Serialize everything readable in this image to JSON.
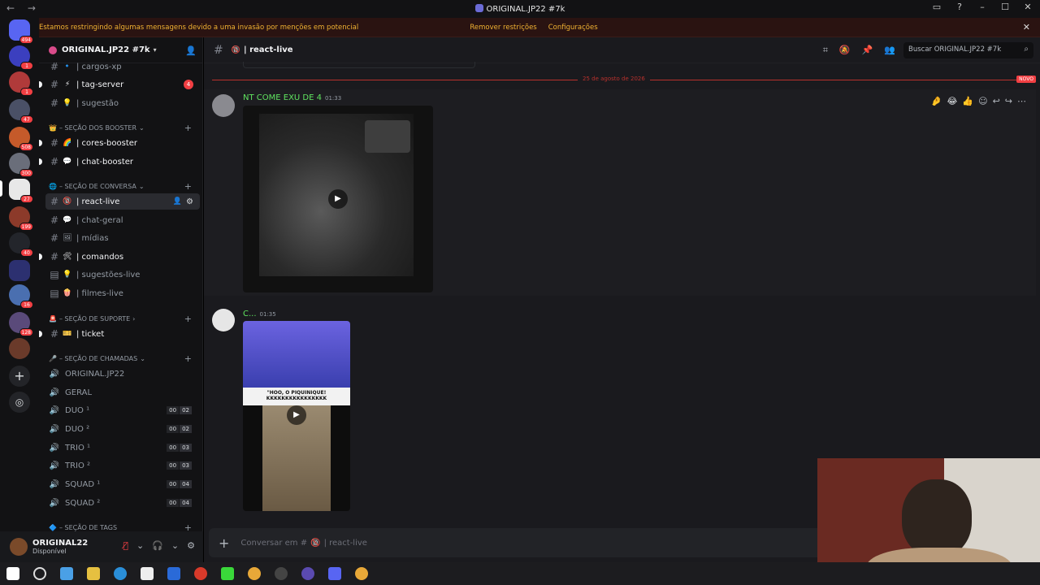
{
  "window": {
    "title": "ORIGINAL.JP22 #7k"
  },
  "banner": {
    "message": "Estamos restringindo algumas mensagens devido a uma invasão por menções em potencial",
    "remove_label": "Remover restrições",
    "settings_label": "Configurações"
  },
  "servers": {
    "home_badge": "494",
    "badges": [
      "1",
      "1",
      "47",
      "508",
      "300",
      "27",
      "199",
      "40",
      "16",
      "128"
    ]
  },
  "guild": {
    "name": "ORIGINAL.JP22 #7k"
  },
  "channels": {
    "cargos_xp": "| cargos-xp",
    "tag_server": "| tag-server",
    "tag_server_mentions": "4",
    "sugestao": "| sugestão",
    "cat_booster": "SEÇÃO DOS BOOSTER",
    "cores_booster": "| cores-booster",
    "chat_booster": "| chat-booster",
    "cat_conversa": "SEÇÃO DE CONVERSA",
    "react_live": "| react-live",
    "chat_geral": "| chat-geral",
    "midias": "| mídias",
    "comandos": "| comandos",
    "sugestoes_live": "| sugestões-live",
    "filmes_live": "| filmes-live",
    "cat_suporte": "SEÇÃO DE SUPORTE",
    "ticket": "| ticket",
    "cat_chamadas": "SEÇÃO DE CHAMADAS",
    "voice": [
      {
        "name": "ORIGINAL.JP22"
      },
      {
        "name": "GERAL"
      },
      {
        "name": "DUO ¹",
        "count": "00",
        "limit": "02"
      },
      {
        "name": "DUO ²",
        "count": "00",
        "limit": "02"
      },
      {
        "name": "TRIO ¹",
        "count": "00",
        "limit": "03"
      },
      {
        "name": "TRIO ²",
        "count": "00",
        "limit": "03"
      },
      {
        "name": "SQUAD ¹",
        "count": "00",
        "limit": "04"
      },
      {
        "name": "SQUAD ²",
        "count": "00",
        "limit": "04"
      }
    ],
    "cat_tags": "SEÇÃO DE TAGS"
  },
  "user": {
    "name": "ORIGINAL22",
    "status": "Disponível"
  },
  "header": {
    "channel": "| react-live",
    "search_placeholder": "Buscar ORIGINAL.JP22 #7k"
  },
  "chat": {
    "date_divider": "25 de agosto de 2026",
    "new_label": "NOVO",
    "messages": [
      {
        "author": "NT COME EXU DE 4",
        "time": "01:33"
      },
      {
        "author": "C...",
        "time": "01:35",
        "caption": "\"HOO, O PIQUINIQUE! KKKKKKKKKKKKKKKK"
      }
    ]
  },
  "composer": {
    "placeholder": "Conversar em #",
    "channel": "| react-live"
  },
  "colors": {
    "accent": "#5865f2",
    "danger": "#f23f43",
    "warning": "#f0b232",
    "author_green": "#5fe35f"
  }
}
